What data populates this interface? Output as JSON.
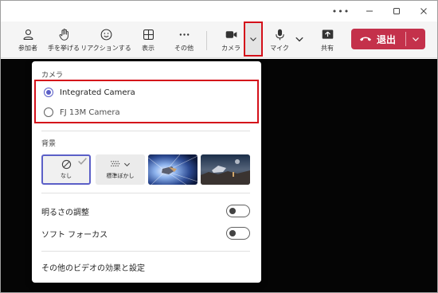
{
  "window": {
    "controls": [
      "more-icon",
      "minimize-icon",
      "maximize-icon",
      "close-icon"
    ]
  },
  "toolbar": {
    "participants": "参加者",
    "raise_hand": "手を挙げる",
    "reactions": "リアクションする",
    "view": "表示",
    "more": "その他",
    "camera": "カメラ",
    "mic": "マイク",
    "share": "共有",
    "leave": "退出"
  },
  "panel": {
    "camera_heading": "カメラ",
    "cameras": [
      {
        "label": "Integrated Camera",
        "selected": true
      },
      {
        "label": "FJ 13M Camera",
        "selected": false
      }
    ],
    "background_heading": "背景",
    "backgrounds": {
      "none": "なし",
      "blur": "標準ぼかし",
      "selected": "なし"
    },
    "brightness_label": "明るさの調整",
    "brightness_on": false,
    "soft_focus_label": "ソフト フォーカス",
    "soft_focus_on": false,
    "more_settings": "その他のビデオの効果と設定"
  },
  "colors": {
    "accent": "#5b5fc7",
    "leave": "#c4314b",
    "highlight": "#d4101a",
    "stage": "#050505"
  }
}
